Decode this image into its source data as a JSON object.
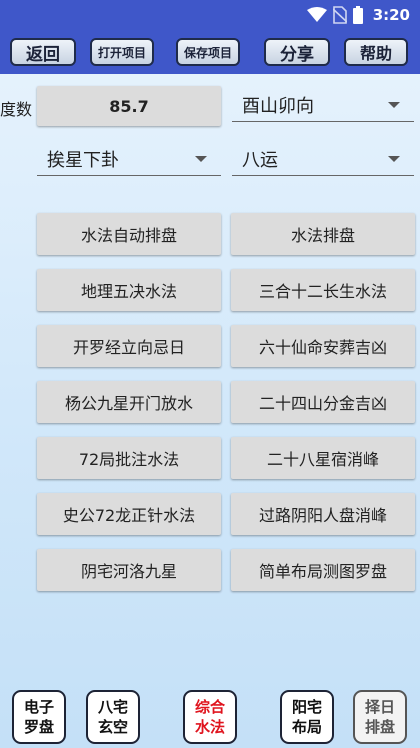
{
  "status": {
    "time": "3:20"
  },
  "toolbar": {
    "back": "返回",
    "open": "打开项目",
    "save": "保存项目",
    "share": "分享",
    "help": "帮助"
  },
  "form": {
    "degree_label": "度数",
    "degree_value": "85.7",
    "direction_select": "酉山卯向",
    "star_select": "挨星下卦",
    "period_select": "八运"
  },
  "grid": [
    [
      "水法自动排盘",
      "水法排盘"
    ],
    [
      "地理五决水法",
      "三合十二长生水法"
    ],
    [
      "开罗经立向忌日",
      "六十仙命安葬吉凶"
    ],
    [
      "杨公九星开门放水",
      "二十四山分金吉凶"
    ],
    [
      "72局批注水法",
      "二十八星宿消峰"
    ],
    [
      "史公72龙正针水法",
      "过路阴阳人盘消峰"
    ],
    [
      "阴宅河洛九星",
      "简单布局测图罗盘"
    ]
  ],
  "bottom_nav": [
    {
      "l1": "电子",
      "l2": "罗盘"
    },
    {
      "l1": "八宅",
      "l2": "玄空"
    },
    {
      "l1": "综合",
      "l2": "水法"
    },
    {
      "l1": "阳宅",
      "l2": "布局"
    },
    {
      "l1": "择日",
      "l2": "排盘"
    }
  ]
}
